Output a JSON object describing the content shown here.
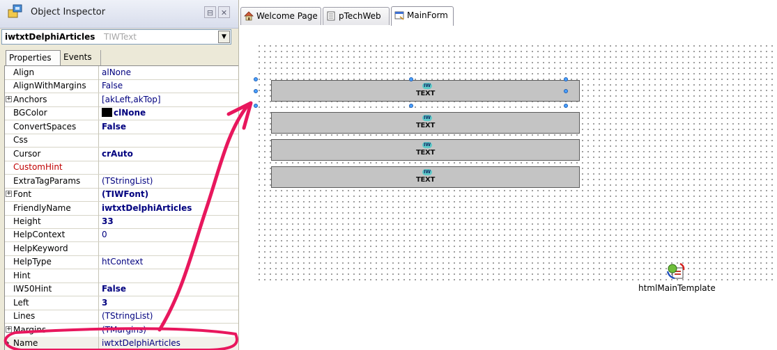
{
  "inspector": {
    "title": "Object Inspector",
    "selected_object": {
      "name": "iwtxtDelphiArticles",
      "type": "TIWText"
    },
    "tabs": [
      "Properties",
      "Events"
    ],
    "properties": [
      {
        "name": "Align",
        "value": "alNone",
        "bold": false,
        "expandable": false
      },
      {
        "name": "AlignWithMargins",
        "value": "False",
        "bold": false,
        "expandable": false
      },
      {
        "name": "Anchors",
        "value": "[akLeft,akTop]",
        "bold": false,
        "expandable": true
      },
      {
        "name": "BGColor",
        "value": "clNone",
        "bold": true,
        "expandable": false,
        "swatch": "#000000"
      },
      {
        "name": "ConvertSpaces",
        "value": "False",
        "bold": true,
        "expandable": false
      },
      {
        "name": "Css",
        "value": "",
        "bold": false,
        "expandable": false
      },
      {
        "name": "Cursor",
        "value": "crAuto",
        "bold": true,
        "expandable": false
      },
      {
        "name": "CustomHint",
        "value": "",
        "bold": false,
        "expandable": false,
        "red": true
      },
      {
        "name": "ExtraTagParams",
        "value": "(TStringList)",
        "bold": false,
        "expandable": false
      },
      {
        "name": "Font",
        "value": "(TIWFont)",
        "bold": true,
        "expandable": true
      },
      {
        "name": "FriendlyName",
        "value": "iwtxtDelphiArticles",
        "bold": true,
        "expandable": false
      },
      {
        "name": "Height",
        "value": "33",
        "bold": true,
        "expandable": false
      },
      {
        "name": "HelpContext",
        "value": "0",
        "bold": false,
        "expandable": false
      },
      {
        "name": "HelpKeyword",
        "value": "",
        "bold": false,
        "expandable": false
      },
      {
        "name": "HelpType",
        "value": "htContext",
        "bold": false,
        "expandable": false
      },
      {
        "name": "Hint",
        "value": "",
        "bold": false,
        "expandable": false
      },
      {
        "name": "IW50Hint",
        "value": "False",
        "bold": true,
        "expandable": false
      },
      {
        "name": "Left",
        "value": "3",
        "bold": true,
        "expandable": false
      },
      {
        "name": "Lines",
        "value": "(TStringList)",
        "bold": false,
        "expandable": false
      },
      {
        "name": "Margins",
        "value": "(TMargins)",
        "bold": false,
        "expandable": true
      },
      {
        "name": "Name",
        "value": "iwtxtDelphiArticles",
        "bold": false,
        "expandable": false,
        "selected": true
      }
    ]
  },
  "designer": {
    "tabs": [
      {
        "label": "Welcome Page",
        "icon": "house-icon"
      },
      {
        "label": "pTechWeb",
        "icon": "unit-file-icon"
      },
      {
        "label": "MainForm",
        "icon": "form-icon",
        "active": true
      }
    ],
    "components": [
      {
        "type": "IWText",
        "badge": "IW",
        "caption": "TEXT",
        "selected": true
      },
      {
        "type": "IWText",
        "badge": "IW",
        "caption": "TEXT"
      },
      {
        "type": "IWText",
        "badge": "IW",
        "caption": "TEXT"
      },
      {
        "type": "IWText",
        "badge": "IW",
        "caption": "TEXT"
      }
    ],
    "template_component": {
      "label": "htmlMainTemplate",
      "icon": "template-processor-icon"
    }
  },
  "annotation_color": "#e8175d"
}
